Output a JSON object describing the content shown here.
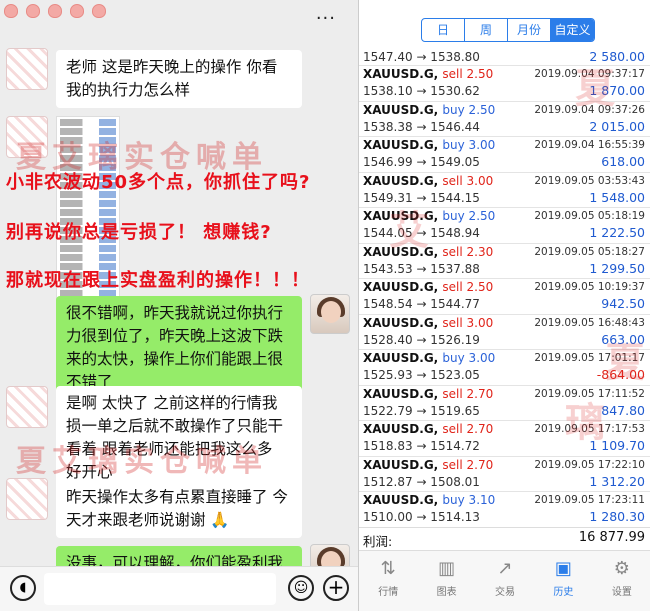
{
  "chat": {
    "messages": [
      {
        "text": "老师 这是昨天晚上的操作 你看我的执行力怎么样"
      },
      {
        "text": "很不错啊，昨天我就说过你执行力很到位了，昨天晚上这波下跌来的太快，操作上你们能跟上很不错了"
      },
      {
        "text": "是啊 太快了 之前这样的行情我损一单之后就不敢操作了只能干看着 跟着老师还能把我这么多 好开心"
      },
      {
        "text": "昨天操作太多有点累直接睡了 今天才来跟老师说谢谢 🙏"
      },
      {
        "text": "没事，可以理解，你们能盈利我才"
      }
    ],
    "overlay_lines": [
      "小非农波动50多个点，你抓住了吗?",
      "别再说你总是亏损了！ 想赚钱?",
      "那就现在跟上实盘盈利的操作！！！"
    ],
    "watermark": "夏艾璃实仓喊单",
    "more_menu": "···"
  },
  "composer": {
    "voice_icon": "voice-icon",
    "emoji_icon": "emoji-icon",
    "plus_icon": "plus-icon"
  },
  "trade": {
    "tabs": [
      {
        "label": "日",
        "active": false
      },
      {
        "label": "周",
        "active": false
      },
      {
        "label": "月份",
        "active": false
      },
      {
        "label": "自定义",
        "active": true
      }
    ],
    "first_deal": {
      "price": "1547.40 → 1538.80",
      "profit": "2 580.00"
    },
    "deals": [
      {
        "symbol": "XAUUSD.G,",
        "side": "sell 2.50",
        "type": "sell",
        "date": "2019.09.04 09:37:17",
        "price": "1538.10 → 1530.62",
        "profit": "1 870.00"
      },
      {
        "symbol": "XAUUSD.G,",
        "side": "buy 2.50",
        "type": "buy",
        "date": "2019.09.04 09:37:26",
        "price": "1538.38 → 1546.44",
        "profit": "2 015.00"
      },
      {
        "symbol": "XAUUSD.G,",
        "side": "buy 3.00",
        "type": "buy",
        "date": "2019.09.04 16:55:39",
        "price": "1546.99 → 1549.05",
        "profit": "618.00"
      },
      {
        "symbol": "XAUUSD.G,",
        "side": "sell 3.00",
        "type": "sell",
        "date": "2019.09.05 03:53:43",
        "price": "1549.31 → 1544.15",
        "profit": "1 548.00"
      },
      {
        "symbol": "XAUUSD.G,",
        "side": "buy 2.50",
        "type": "buy",
        "date": "2019.09.05 05:18:19",
        "price": "1544.05 → 1548.94",
        "profit": "1 222.50"
      },
      {
        "symbol": "XAUUSD.G,",
        "side": "sell 2.30",
        "type": "sell",
        "date": "2019.09.05 05:18:27",
        "price": "1543.53 → 1537.88",
        "profit": "1 299.50"
      },
      {
        "symbol": "XAUUSD.G,",
        "side": "sell 2.50",
        "type": "sell",
        "date": "2019.09.05 10:19:37",
        "price": "1548.54 → 1544.77",
        "profit": "942.50"
      },
      {
        "symbol": "XAUUSD.G,",
        "side": "sell 3.00",
        "type": "sell",
        "date": "2019.09.05 16:48:43",
        "price": "1528.40 → 1526.19",
        "profit": "663.00"
      },
      {
        "symbol": "XAUUSD.G,",
        "side": "buy 3.00",
        "type": "buy",
        "date": "2019.09.05 17:01:17",
        "price": "1525.93 → 1523.05",
        "profit": "-864.00",
        "negative": true
      },
      {
        "symbol": "XAUUSD.G,",
        "side": "sell 2.70",
        "type": "sell",
        "date": "2019.09.05 17:11:52",
        "price": "1522.79 → 1519.65",
        "profit": "847.80"
      },
      {
        "symbol": "XAUUSD.G,",
        "side": "sell 2.70",
        "type": "sell",
        "date": "2019.09.05 17:17:53",
        "price": "1518.83 → 1514.72",
        "profit": "1 109.70"
      },
      {
        "symbol": "XAUUSD.G,",
        "side": "sell 2.70",
        "type": "sell",
        "date": "2019.09.05 17:22:10",
        "price": "1512.87 → 1508.01",
        "profit": "1 312.20"
      },
      {
        "symbol": "XAUUSD.G,",
        "side": "buy 3.10",
        "type": "buy",
        "date": "2019.09.05 17:23:11",
        "price": "1510.00 → 1514.13",
        "profit": "1 280.30"
      }
    ],
    "total_label": "利润:",
    "total_value": "16 877.99",
    "watermark_chars": [
      "夏",
      "艾",
      "璃",
      "夏"
    ],
    "nav": [
      {
        "label": "行情",
        "icon": "quotes-icon",
        "glyph": "⇅",
        "active": false
      },
      {
        "label": "图表",
        "icon": "chart-icon",
        "glyph": "▥",
        "active": false
      },
      {
        "label": "交易",
        "icon": "trade-icon",
        "glyph": "↗",
        "active": false
      },
      {
        "label": "历史",
        "icon": "history-icon",
        "glyph": "▣",
        "active": true
      },
      {
        "label": "设置",
        "icon": "settings-icon",
        "glyph": "⚙",
        "active": false
      }
    ]
  }
}
